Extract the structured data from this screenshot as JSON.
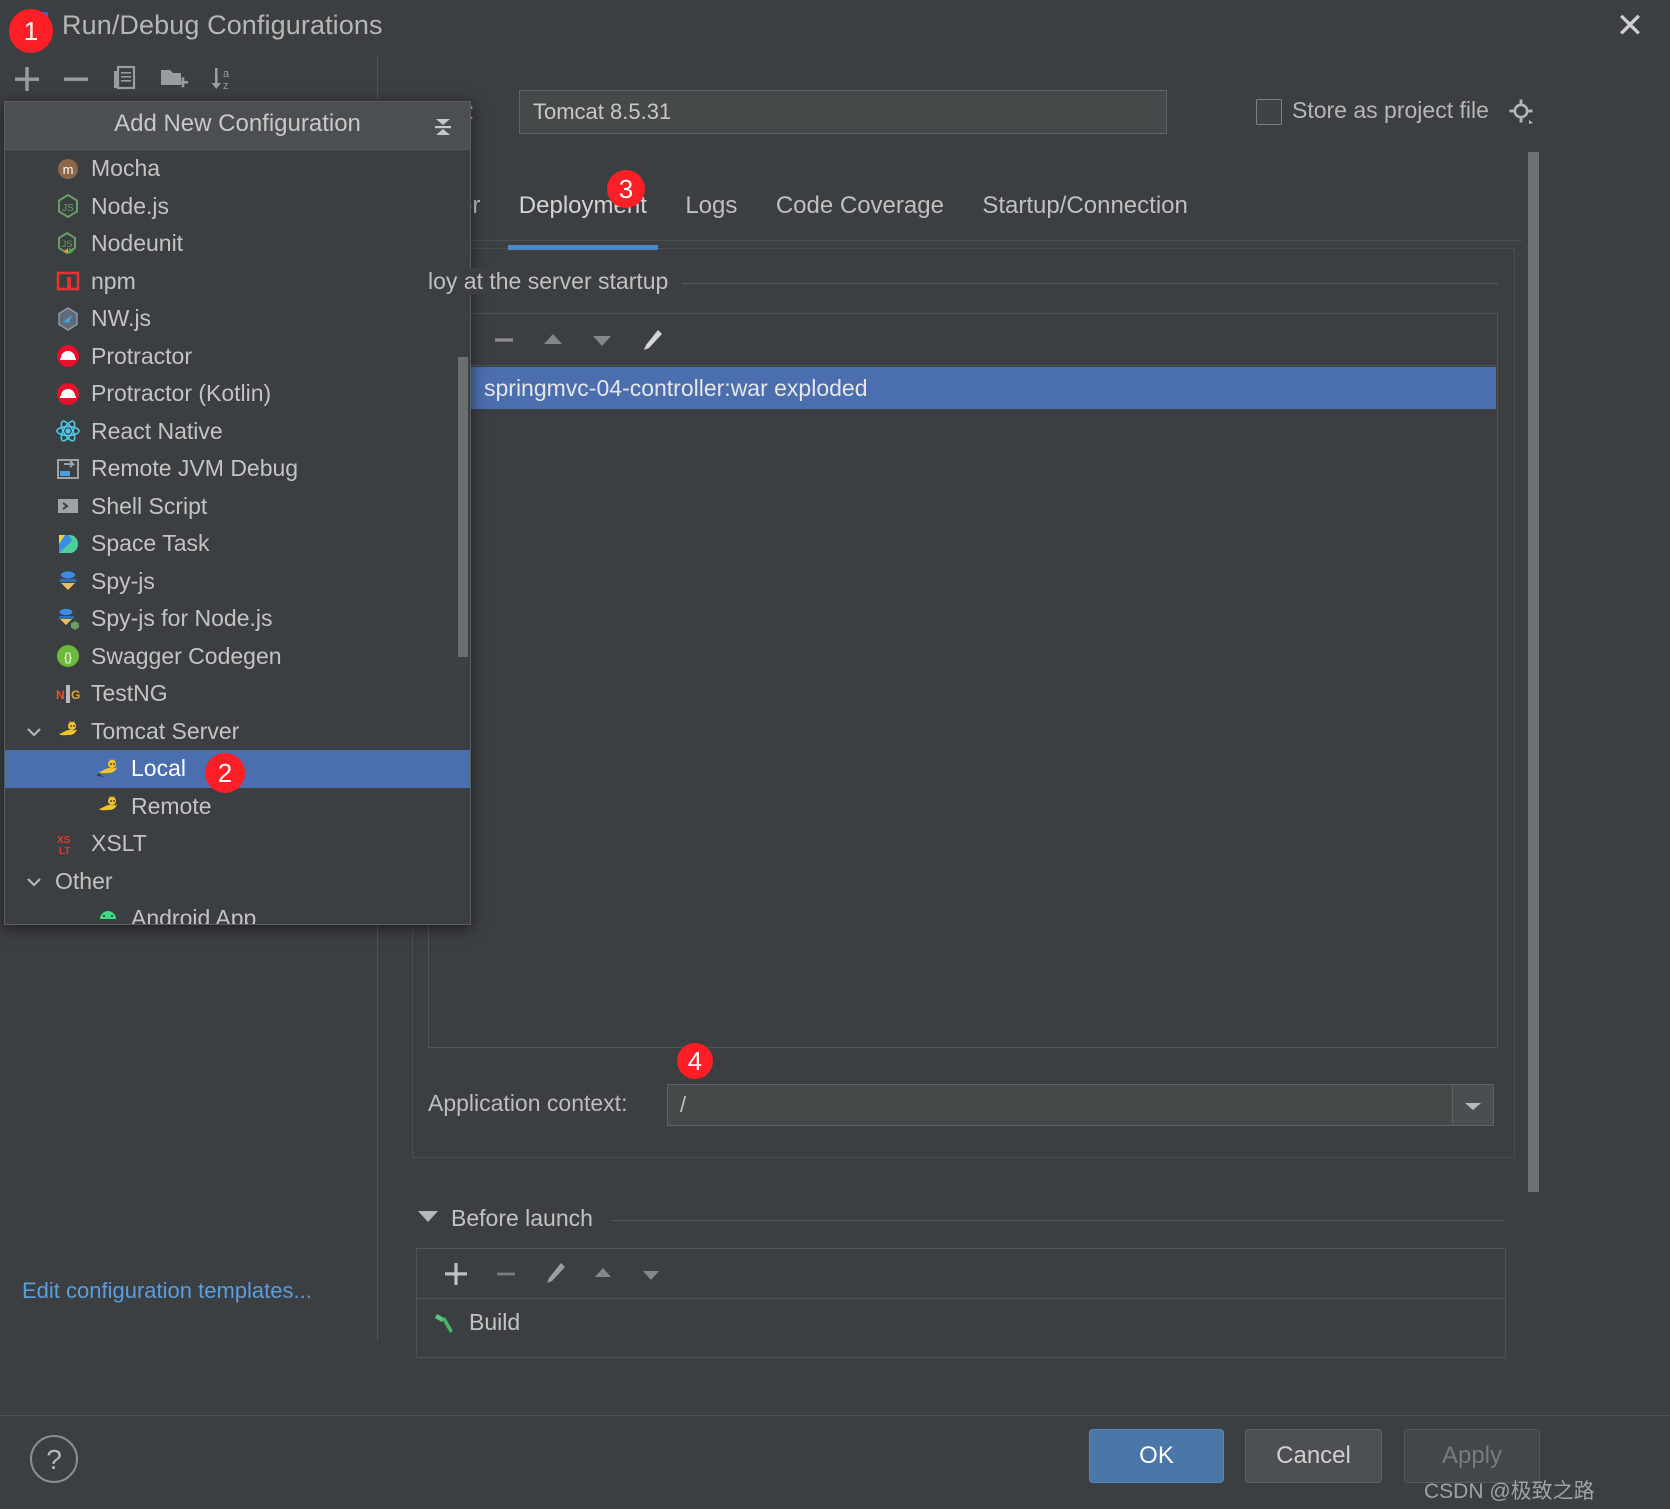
{
  "window": {
    "title": "Run/Debug Configurations",
    "close_label": "✕",
    "app_icon": "intellij-idea-icon"
  },
  "toolbar": {
    "items": [
      {
        "name": "add-configuration-button",
        "icon": "plus-icon"
      },
      {
        "name": "remove-configuration-button",
        "icon": "minus-icon"
      },
      {
        "name": "copy-configuration-button",
        "icon": "copy-icon"
      },
      {
        "name": "new-folder-button",
        "icon": "folder-add-icon"
      },
      {
        "name": "sort-configurations-button",
        "icon": "sort-az-icon"
      }
    ]
  },
  "left_panel": {
    "edit_templates_link": "Edit configuration templates..."
  },
  "popup": {
    "title": "Add New Configuration",
    "collapse_icon": "collapse-all-icon",
    "items": [
      {
        "label": "Mocha",
        "icon": "mocha-icon",
        "indent": 0,
        "expander": "",
        "selected": false
      },
      {
        "label": "Node.js",
        "icon": "nodejs-icon",
        "indent": 0,
        "expander": "",
        "selected": false
      },
      {
        "label": "Nodeunit",
        "icon": "nodeunit-icon",
        "indent": 0,
        "expander": "",
        "selected": false
      },
      {
        "label": "npm",
        "icon": "npm-icon",
        "indent": 0,
        "expander": "",
        "selected": false
      },
      {
        "label": "NW.js",
        "icon": "nwjs-icon",
        "indent": 0,
        "expander": "",
        "selected": false
      },
      {
        "label": "Protractor",
        "icon": "protractor-icon",
        "indent": 0,
        "expander": "",
        "selected": false
      },
      {
        "label": "Protractor (Kotlin)",
        "icon": "protractor-icon",
        "indent": 0,
        "expander": "",
        "selected": false
      },
      {
        "label": "React Native",
        "icon": "react-native-icon",
        "indent": 0,
        "expander": "",
        "selected": false
      },
      {
        "label": "Remote JVM Debug",
        "icon": "remote-debug-icon",
        "indent": 0,
        "expander": "",
        "selected": false
      },
      {
        "label": "Shell Script",
        "icon": "shell-script-icon",
        "indent": 0,
        "expander": "",
        "selected": false
      },
      {
        "label": "Space Task",
        "icon": "space-task-icon",
        "indent": 0,
        "expander": "",
        "selected": false
      },
      {
        "label": "Spy-js",
        "icon": "spyjs-icon",
        "indent": 0,
        "expander": "",
        "selected": false
      },
      {
        "label": "Spy-js for Node.js",
        "icon": "spyjs-node-icon",
        "indent": 0,
        "expander": "",
        "selected": false
      },
      {
        "label": "Swagger Codegen",
        "icon": "swagger-icon",
        "indent": 0,
        "expander": "",
        "selected": false
      },
      {
        "label": "TestNG",
        "icon": "testng-icon",
        "indent": 0,
        "expander": "",
        "selected": false
      },
      {
        "label": "Tomcat Server",
        "icon": "tomcat-icon",
        "indent": 0,
        "expander": "down",
        "selected": false
      },
      {
        "label": "Local",
        "icon": "tomcat-icon",
        "indent": 1,
        "expander": "",
        "selected": true
      },
      {
        "label": "Remote",
        "icon": "tomcat-icon",
        "indent": 1,
        "expander": "",
        "selected": false
      },
      {
        "label": "XSLT",
        "icon": "xslt-icon",
        "indent": 0,
        "expander": "",
        "selected": false
      },
      {
        "label": "Other",
        "icon": "",
        "indent": 0,
        "expander": "down",
        "selected": false
      },
      {
        "label": "Android App",
        "icon": "android-icon",
        "indent": 1,
        "expander": "",
        "selected": false
      }
    ]
  },
  "main": {
    "name_label": ":",
    "name_value": "Tomcat 8.5.31",
    "store_as_project_file_label": "Store as project file",
    "store_as_project_file_checked": false,
    "gear_icon": "gear-icon",
    "tabs": [
      {
        "label": "ver",
        "active": false
      },
      {
        "label": "Deployment",
        "active": true
      },
      {
        "label": "Logs",
        "active": false
      },
      {
        "label": "Code Coverage",
        "active": false
      },
      {
        "label": "Startup/Connection",
        "active": false
      }
    ],
    "deploy_section_title": "loy at the server startup",
    "deploy_toolbar": [
      {
        "name": "remove-artifact-button",
        "icon": "minus-icon"
      },
      {
        "name": "move-up-button",
        "icon": "arrow-up-icon"
      },
      {
        "name": "move-down-button",
        "icon": "arrow-down-icon"
      },
      {
        "name": "edit-artifact-button",
        "icon": "pencil-icon"
      }
    ],
    "deploy_items": [
      {
        "label": "springmvc-04-controller:war exploded",
        "selected": true
      }
    ],
    "application_context_label": "Application context:",
    "application_context_value": "/",
    "before_launch_label": "Before launch",
    "before_launch_toolbar": [
      {
        "name": "add-task-button",
        "icon": "plus-icon"
      },
      {
        "name": "remove-task-button",
        "icon": "minus-icon"
      },
      {
        "name": "edit-task-button",
        "icon": "pencil-icon"
      },
      {
        "name": "task-move-up-button",
        "icon": "arrow-up-icon"
      },
      {
        "name": "task-move-down-button",
        "icon": "arrow-down-icon"
      }
    ],
    "before_launch_items": [
      {
        "label": "Build",
        "icon": "build-hammer-icon"
      }
    ]
  },
  "footer": {
    "help_label": "?",
    "ok_label": "OK",
    "cancel_label": "Cancel",
    "apply_label": "Apply",
    "watermark": "CSDN @极致之路"
  },
  "annotations": [
    {
      "number": "1"
    },
    {
      "number": "2"
    },
    {
      "number": "3"
    },
    {
      "number": "4"
    }
  ],
  "colors": {
    "background": "#3c3f41",
    "selection": "#4b6eaf",
    "accent": "#4a88c7",
    "link": "#5c9ddb",
    "badge": "#fd1f25",
    "text": "#bbbbbb"
  }
}
